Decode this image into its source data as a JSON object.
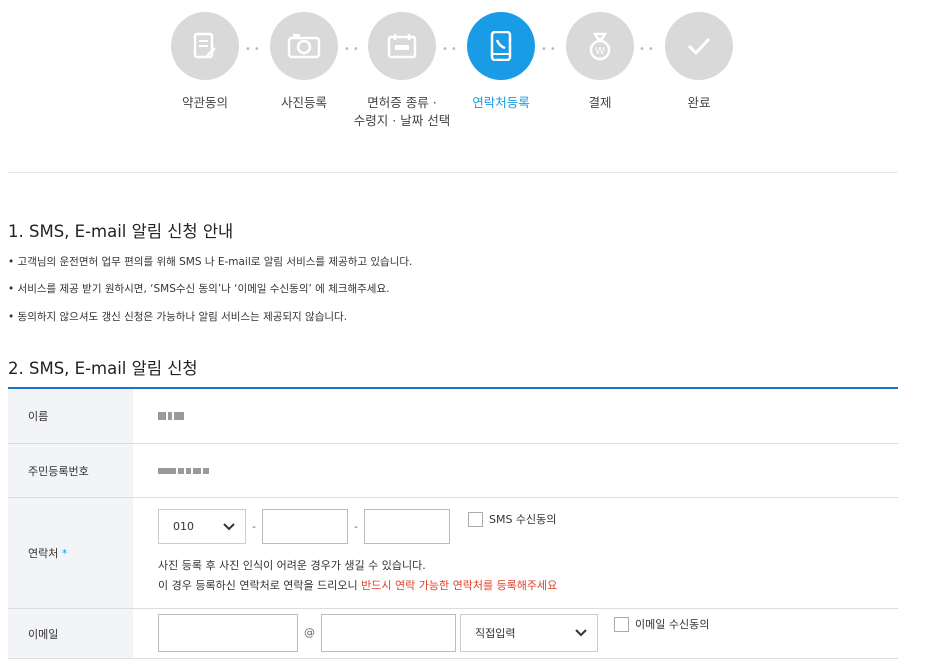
{
  "stepper": {
    "steps": [
      {
        "label": "약관동의",
        "icon": "document-pen-icon"
      },
      {
        "label": "사진등록",
        "icon": "camera-icon"
      },
      {
        "label": "면허증 종류 ·",
        "label2": "수령지 · 날짜 선택",
        "icon": "card-icon"
      },
      {
        "label": "연락처등록",
        "icon": "phone-icon"
      },
      {
        "label": "결제",
        "icon": "money-bag-icon"
      },
      {
        "label": "완료",
        "icon": "check-icon"
      }
    ],
    "active_index": 3
  },
  "section1": {
    "title": "1. SMS, E-mail 알림 신청 안내",
    "notices": [
      "• 고객님의 운전면허 업무 편의를 위해 SMS 나 E-mail로 알림 서비스를 제공하고 있습니다.",
      "• 서비스를 제공 받기 원하시면, ‘SMS수신 동의’나 ‘이메일 수신동의’ 에 체크해주세요.",
      "• 동의하지 않으셔도 갱신 신청은 가능하나 알림 서비스는 제공되지 않습니다."
    ]
  },
  "section2": {
    "title": "2. SMS, E-mail 알림 신청",
    "name_label": "이름",
    "rrn_label": "주민등록번호",
    "phone_label": "연락처",
    "required_mark": "*",
    "phone_prefix": "010",
    "dash": "-",
    "sms_consent": "SMS 수신동의",
    "help_line1": "사진 등록 후 사진 인식이 어려운 경우가 생길 수 있습니다.",
    "help_line2": "이 경우 등록하신 연락처로 연락을 드리오니 ",
    "help_line2_red": "반드시 연락 가능한 연락처를 등록해주세요",
    "email_label": "이메일",
    "at": "@",
    "domain_select": "직접입력",
    "email_consent": "이메일 수신동의"
  },
  "colors": {
    "accent": "#1a9be6",
    "inactive": "#d9d9d9",
    "table_top": "#1a73c8",
    "warning": "#e0402a"
  }
}
